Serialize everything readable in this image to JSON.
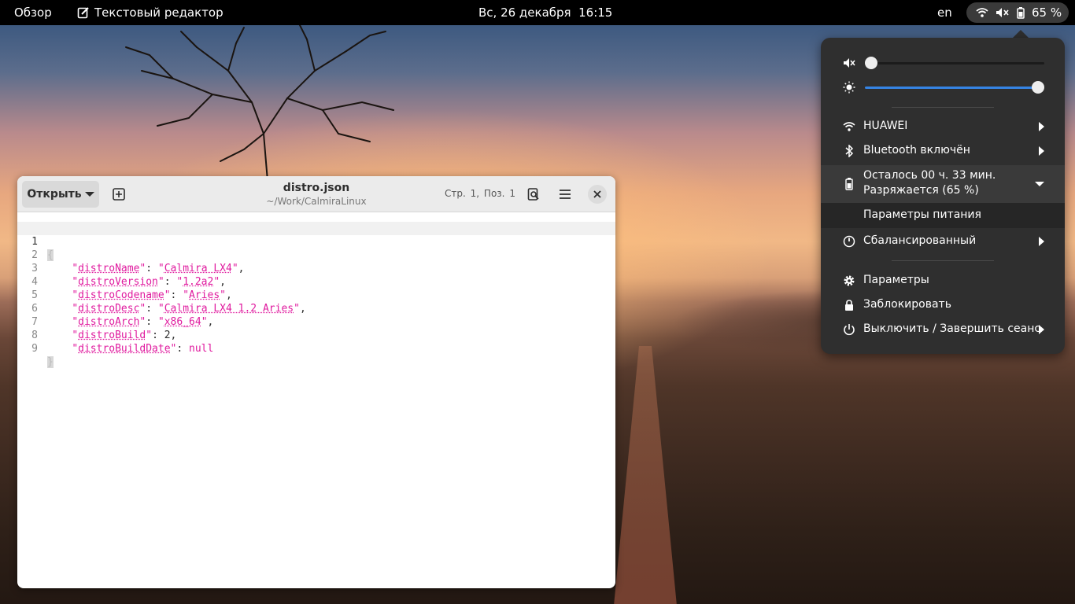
{
  "topbar": {
    "activities": "Обзор",
    "app_name": "Текстовый редактор",
    "app_icon": "text-editor-icon",
    "datetime": "Вс, 26 декабря  16:15",
    "keyboard_layout": "en",
    "battery_percent": "65 %"
  },
  "editor": {
    "open_label": "Открыть",
    "title": "distro.json",
    "path": "~/Work/CalmiraLinux",
    "line_label": "Стр.",
    "line_value": "1,",
    "col_label": "Поз.",
    "col_value": "1",
    "lines": [
      {
        "n": "1"
      },
      {
        "n": "2",
        "key": "distroName",
        "val": "Calmira LX4"
      },
      {
        "n": "3",
        "key": "distroVersion",
        "val": "1.2a2"
      },
      {
        "n": "4",
        "key": "distroCodename",
        "val": "Aries"
      },
      {
        "n": "5",
        "key": "distroDesc",
        "val": "Calmira LX4 1.2 Aries"
      },
      {
        "n": "6",
        "key": "distroArch",
        "val": "x86_64"
      },
      {
        "n": "7",
        "key": "distroBuild",
        "num": "2"
      },
      {
        "n": "8",
        "key": "distroBuildDate",
        "nul": "null"
      },
      {
        "n": "9"
      }
    ]
  },
  "quick_menu": {
    "volume_level": 0.0,
    "brightness_level": 1.0,
    "wifi_label": "HUAWEI",
    "bluetooth_label": "Bluetooth включён",
    "battery_line1": "Осталось 00 ч. 33 мин.",
    "battery_line2": "Разряжается (65 %)",
    "power_settings_label": "Параметры питания",
    "power_mode_label": "Сбалансированный",
    "settings_label": "Параметры",
    "lock_label": "Заблокировать",
    "power_off_label": "Выключить / Завершить сеанс",
    "accent_color": "#3584e4"
  }
}
